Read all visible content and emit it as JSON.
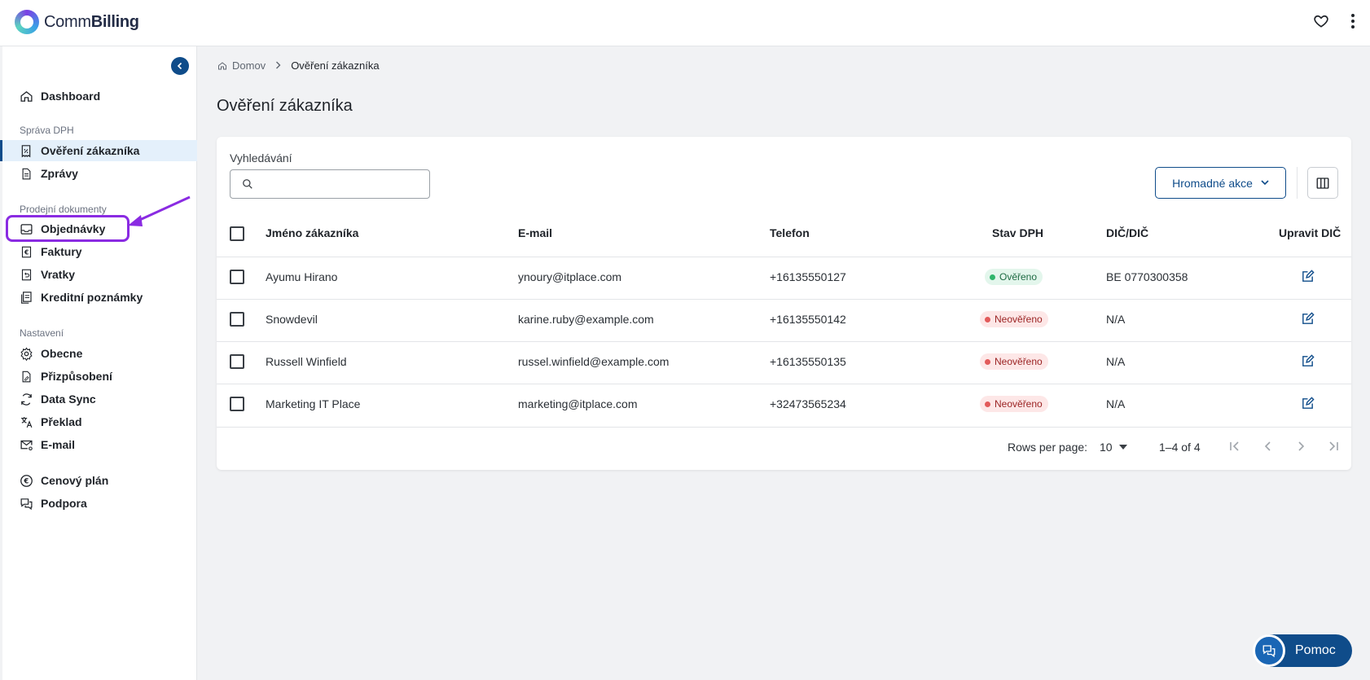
{
  "app": {
    "logo_light": "Comm",
    "logo_bold": "Billing"
  },
  "breadcrumb": {
    "home": "Domov",
    "current": "Ověření zákazníka"
  },
  "page": {
    "title": "Ověření zákazníka"
  },
  "sidebar": {
    "dashboard": "Dashboard",
    "sections": {
      "vat": "Správa DPH",
      "sales": "Prodejní dokumenty",
      "settings": "Nastavení"
    },
    "items": {
      "overeni": "Ověření zákazníka",
      "zpravy": "Zprávy",
      "objednavky": "Objednávky",
      "faktury": "Faktury",
      "vratky": "Vratky",
      "kreditni": "Kreditní poznámky",
      "obecne": "Obecne",
      "prizpusobeni": "Přizpůsobení",
      "datasync": "Data Sync",
      "preklad": "Překlad",
      "email": "E-mail",
      "cenovy": "Cenový plán",
      "podpora": "Podpora"
    }
  },
  "search": {
    "label": "Vyhledávání",
    "value": ""
  },
  "toolbar": {
    "bulk_label": "Hromadné akce"
  },
  "table": {
    "headers": {
      "name": "Jméno zákazníka",
      "email": "E-mail",
      "phone": "Telefon",
      "vat_status": "Stav DPH",
      "vat_id": "DIČ/DIČ",
      "edit": "Upravit DIČ"
    },
    "rows": [
      {
        "name": "Ayumu Hirano",
        "email": "ynoury@itplace.com",
        "phone": "+16135550127",
        "status": "Ověřeno",
        "vat_id": "BE 0770300358"
      },
      {
        "name": "Snowdevil",
        "email": "karine.ruby@example.com",
        "phone": "+16135550142",
        "status": "Neověřeno",
        "vat_id": "N/A"
      },
      {
        "name": "Russell Winfield",
        "email": "russel.winfield@example.com",
        "phone": "+16135550135",
        "status": "Neověřeno",
        "vat_id": "N/A"
      },
      {
        "name": "Marketing IT Place",
        "email": "marketing@itplace.com",
        "phone": "+32473565234",
        "status": "Neověřeno",
        "vat_id": "N/A"
      }
    ]
  },
  "pagination": {
    "rows_label": "Rows per page:",
    "rows_value": "10",
    "range": "1–4 of 4"
  },
  "help": {
    "label": "Pomoc"
  },
  "colors": {
    "primary": "#0f4c8a",
    "highlight": "#8a2be2",
    "ok": "#2fb56b",
    "bad": "#e25a5a"
  }
}
